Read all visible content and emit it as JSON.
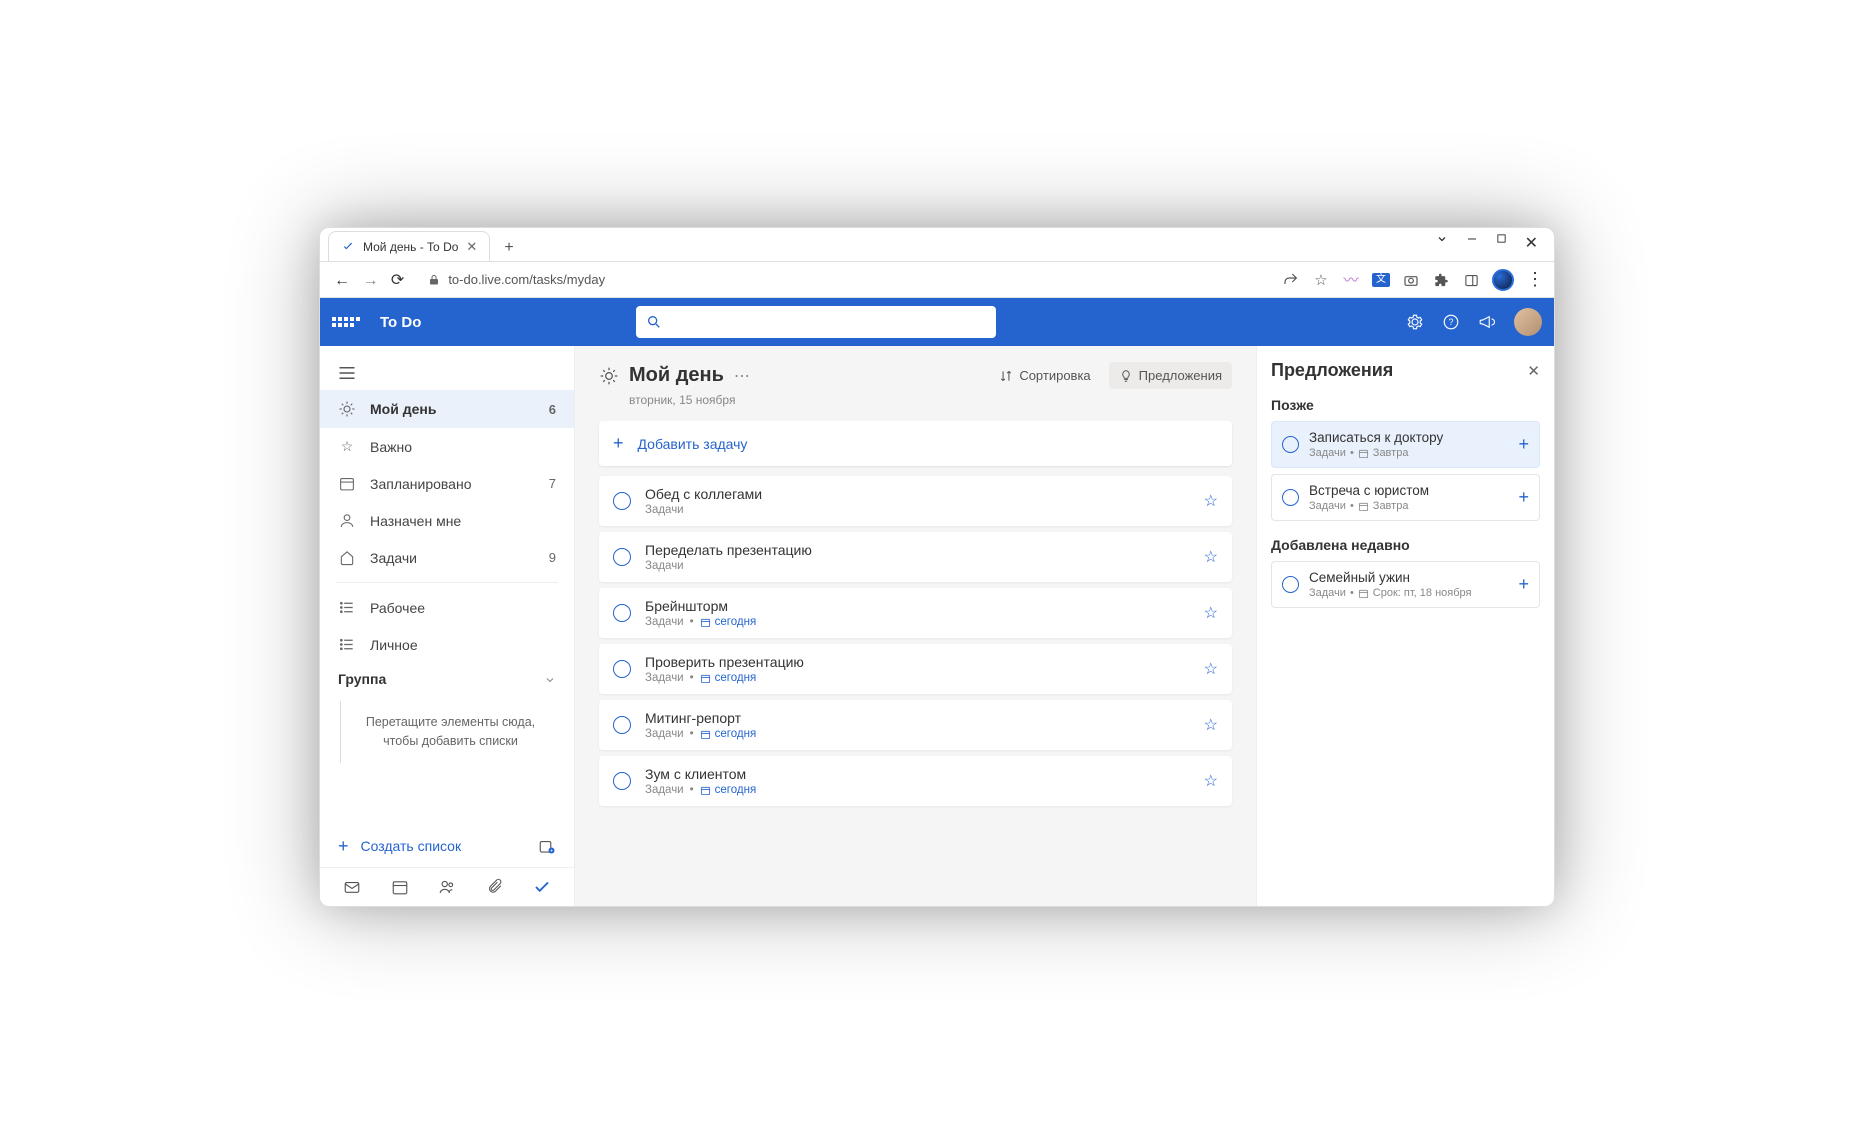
{
  "browser": {
    "tab_title": "Мой день - To Do",
    "url": "to-do.live.com/tasks/myday"
  },
  "app": {
    "title": "To Do"
  },
  "sidebar": {
    "items": [
      {
        "label": "Мой день",
        "count": "6"
      },
      {
        "label": "Важно",
        "count": ""
      },
      {
        "label": "Запланировано",
        "count": "7"
      },
      {
        "label": "Назначен мне",
        "count": ""
      },
      {
        "label": "Задачи",
        "count": "9"
      }
    ],
    "custom": [
      {
        "label": "Рабочее"
      },
      {
        "label": "Личное"
      }
    ],
    "group_label": "Группа",
    "drop_hint": "Перетащите элементы сюда, чтобы добавить списки",
    "create_list_label": "Создать список"
  },
  "main": {
    "title": "Мой день",
    "date": "вторник, 15 ноября",
    "sort_label": "Сортировка",
    "suggestions_label": "Предложения",
    "add_task_label": "Добавить задачу",
    "tasks": [
      {
        "title": "Обед с коллегами",
        "list": "Задачи",
        "due": ""
      },
      {
        "title": "Переделать презентацию",
        "list": "Задачи",
        "due": ""
      },
      {
        "title": "Брейншторм",
        "list": "Задачи",
        "due": "сегодня"
      },
      {
        "title": "Проверить презентацию",
        "list": "Задачи",
        "due": "сегодня"
      },
      {
        "title": "Митинг-репорт",
        "list": "Задачи",
        "due": "сегодня"
      },
      {
        "title": "Зум с клиентом",
        "list": "Задачи",
        "due": "сегодня"
      }
    ]
  },
  "panel": {
    "title": "Предложения",
    "sections": {
      "later_label": "Позже",
      "later": [
        {
          "title": "Записаться к доктору",
          "list": "Задачи",
          "due": "Завтра"
        },
        {
          "title": "Встреча с юристом",
          "list": "Задачи",
          "due": "Завтра"
        }
      ],
      "recent_label": "Добавлена недавно",
      "recent": [
        {
          "title": "Семейный ужин",
          "list": "Задачи",
          "due": "Срок: пт, 18 ноября"
        }
      ]
    }
  }
}
